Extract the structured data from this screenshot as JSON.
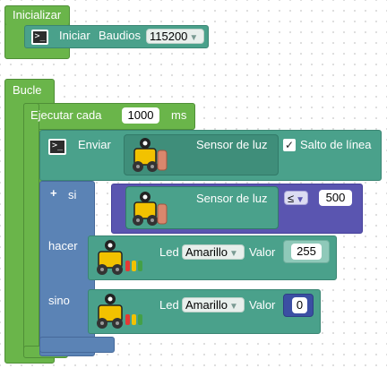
{
  "setup": {
    "title": "Inicializar",
    "serial_label": "Iniciar",
    "baud_label": "Baudios",
    "baud_value": "115200"
  },
  "loop": {
    "title": "Bucle",
    "exec_label": "Ejecutar cada",
    "interval_value": "1000",
    "interval_unit": "ms",
    "send": {
      "label": "Enviar",
      "sensor_label": "Sensor de luz",
      "newline_label": "Salto de línea",
      "newline_checked": true
    },
    "if_block": {
      "if_label": "si",
      "cond_sensor_label": "Sensor de luz",
      "operator": "≤",
      "threshold": "500",
      "then_label": "hacer",
      "else_label": "sino",
      "then_led": {
        "label": "Led",
        "color_value": "Amarillo",
        "value_label": "Valor",
        "value": "255"
      },
      "else_led": {
        "label": "Led",
        "color_value": "Amarillo",
        "value_label": "Valor",
        "value": "0"
      }
    }
  },
  "icons": {
    "terminal": "terminal-icon",
    "robot": "robot-icon",
    "plus": "plus-icon",
    "dropdown": "triangle-down-icon"
  },
  "colors": {
    "setup_loop_block": "#6ab54a",
    "loop_body": "#5aa03e",
    "serial_block": "#4aa18b",
    "if_block": "#5b83b5",
    "condition_block": "#5a55b0"
  }
}
